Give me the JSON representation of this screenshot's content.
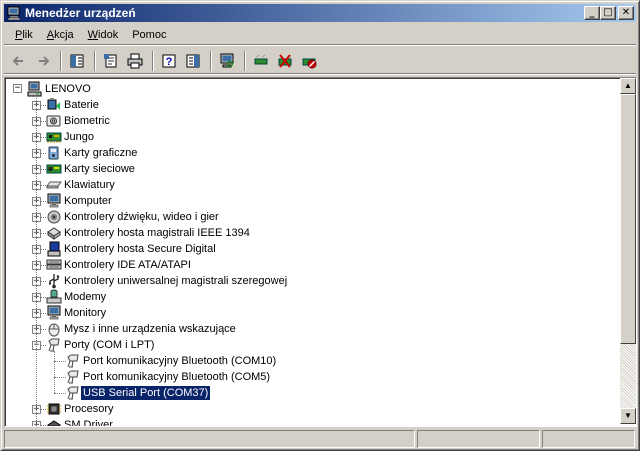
{
  "window": {
    "title": "Menedżer urządzeń"
  },
  "title_buttons": {
    "minimize": "_",
    "maximize": "□",
    "close": "✕"
  },
  "menu": [
    {
      "label": "Plik",
      "accel": "P",
      "rest": "lik"
    },
    {
      "label": "Akcja",
      "accel": "A",
      "rest": "kcja"
    },
    {
      "label": "Widok",
      "accel": "W",
      "rest": "idok"
    },
    {
      "label": "Pomoc",
      "accel": "",
      "rest": "Pomoc"
    }
  ],
  "toolbar": [
    {
      "name": "back-button",
      "icon": "arrow-left-icon"
    },
    {
      "name": "forward-button",
      "icon": "arrow-right-icon"
    },
    {
      "sep": true
    },
    {
      "name": "show-hide-console-tree-button",
      "icon": "console-tree-icon"
    },
    {
      "sep": true
    },
    {
      "name": "properties-button",
      "icon": "properties-icon"
    },
    {
      "name": "print-button",
      "icon": "printer-icon"
    },
    {
      "sep": true
    },
    {
      "name": "help-button",
      "icon": "help-icon"
    },
    {
      "name": "show-hide-action-pane-button",
      "icon": "action-pane-icon"
    },
    {
      "sep": true
    },
    {
      "name": "scan-hardware-button",
      "icon": "monitor-scan-icon"
    },
    {
      "sep": true
    },
    {
      "name": "update-driver-button",
      "icon": "update-driver-icon"
    },
    {
      "name": "uninstall-button",
      "icon": "uninstall-icon"
    },
    {
      "name": "disable-button",
      "icon": "disable-icon"
    }
  ],
  "tree": {
    "root": {
      "label": "LENOVO",
      "icon": "computer-icon"
    },
    "categories": [
      {
        "label": "Baterie",
        "icon": "battery-icon",
        "expanded": false
      },
      {
        "label": "Biometric",
        "icon": "biometric-icon",
        "expanded": false
      },
      {
        "label": "Jungo",
        "icon": "board-icon",
        "expanded": false
      },
      {
        "label": "Karty graficzne",
        "icon": "display-adapter-icon",
        "expanded": false
      },
      {
        "label": "Karty sieciowe",
        "icon": "network-card-icon",
        "expanded": false
      },
      {
        "label": "Klawiatury",
        "icon": "keyboard-icon",
        "expanded": false
      },
      {
        "label": "Komputer",
        "icon": "monitor-icon",
        "expanded": false
      },
      {
        "label": "Kontrolery dźwięku, wideo i gier",
        "icon": "speaker-icon",
        "expanded": false
      },
      {
        "label": "Kontrolery hosta magistrali IEEE 1394",
        "icon": "ieee1394-icon",
        "expanded": false
      },
      {
        "label": "Kontrolery hosta Secure Digital",
        "icon": "sd-host-icon",
        "expanded": false
      },
      {
        "label": "Kontrolery IDE ATA/ATAPI",
        "icon": "ide-icon",
        "expanded": false
      },
      {
        "label": "Kontrolery uniwersalnej magistrali szeregowej",
        "icon": "usb-icon",
        "expanded": false
      },
      {
        "label": "Modemy",
        "icon": "modem-icon",
        "expanded": false
      },
      {
        "label": "Monitory",
        "icon": "monitor-icon",
        "expanded": false
      },
      {
        "label": "Mysz i inne urządzenia wskazujące",
        "icon": "mouse-icon",
        "expanded": false
      },
      {
        "label": "Porty (COM i LPT)",
        "icon": "port-icon",
        "expanded": true,
        "children": [
          {
            "label": "Port komunikacyjny Bluetooth (COM10)",
            "icon": "port-icon",
            "selected": false
          },
          {
            "label": "Port komunikacyjny Bluetooth (COM5)",
            "icon": "port-icon",
            "selected": false
          },
          {
            "label": "USB Serial Port (COM37)",
            "icon": "port-icon",
            "selected": true
          }
        ]
      },
      {
        "label": "Procesory",
        "icon": "processor-icon",
        "expanded": false
      },
      {
        "label": "SM Driver",
        "icon": "chip-icon",
        "expanded": false
      }
    ]
  },
  "colors": {
    "titlebar_start": "#0a246a",
    "titlebar_end": "#a6caf0",
    "selection": "#0a246a",
    "face": "#d4d0c8"
  }
}
